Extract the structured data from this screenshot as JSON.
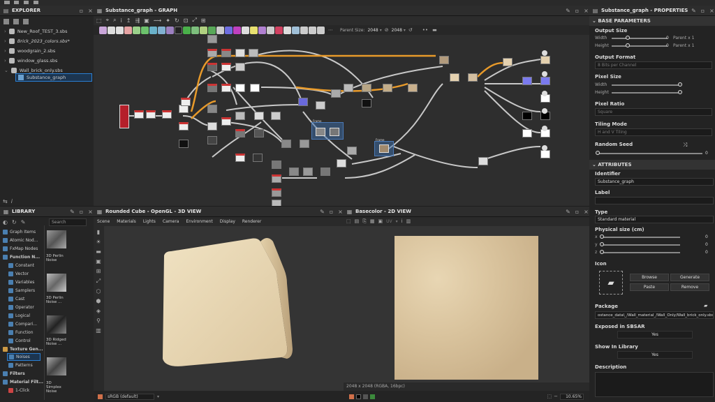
{
  "explorer": {
    "title": "EXPLORER",
    "files": [
      "New_Roof_TEST_3.sbs",
      "Brick_2023_colors.sbs*",
      "woodgrain_2.sbs",
      "window_glass.sbs",
      "Wall_brick_only.sbs"
    ],
    "graph_item": "Substance_graph"
  },
  "graph": {
    "title": "Substance_graph - GRAPH",
    "parent_size_label": "Parent Size:",
    "parent_size_value": "2048",
    "size_value": "2048",
    "frame_label_1": "Frame",
    "frame_label_2": "Frame"
  },
  "properties": {
    "title": "Substance_graph - PROPERTIES",
    "base_params": "BASE PARAMETERS",
    "output_size": "Output Size",
    "width_label": "Width",
    "height_label": "Height",
    "width_val": "0",
    "height_val": "0",
    "parent_x1a": "Parent x 1",
    "parent_x1b": "Parent x 1",
    "output_format": "Output Format",
    "output_format_val": "8 Bits per Channel",
    "pixel_size": "Pixel Size",
    "px_width": "Width",
    "px_height": "Height",
    "pixel_ratio": "Pixel Ratio",
    "pixel_ratio_val": "Square",
    "tiling_mode": "Tiling Mode",
    "tiling_val": "H and V Tiling",
    "random_seed": "Random Seed",
    "seed_val": "0",
    "attributes": "ATTRIBUTES",
    "identifier": "Identifier",
    "identifier_val": "Substance_graph",
    "label": "Label",
    "type": "Type",
    "type_val": "Standard material",
    "physical_size": "Physical size (cm)",
    "px": "x",
    "py": "y",
    "pz": "z",
    "pxv": "0",
    "pyv": "0",
    "pzv": "0",
    "icon": "Icon",
    "browse": "Browse",
    "generate": "Generate",
    "paste": "Paste",
    "remove": "Remove",
    "package": "Package",
    "package_val": "ostance_data\\_/Wall_material_/Wall_Only/Wall_brick_only.sbs",
    "exposed": "Exposed in SBSAR",
    "exposed_val": "Yes",
    "show_lib": "Show In Library",
    "show_lib_val": "Yes",
    "description": "Description"
  },
  "library": {
    "title": "LIBRARY",
    "search_placeholder": "Search",
    "items": [
      "Graph Items",
      "Atomic Nod...",
      "FxMap Nodes",
      "Function N...",
      "Constant",
      "Vector",
      "Variables",
      "Samplers",
      "Cast",
      "Operator",
      "Logical",
      "Compari...",
      "Function",
      "Control",
      "Texture Gen...",
      "Noises",
      "Patterns",
      "Filters",
      "Material Filt...",
      "1-Click"
    ],
    "thumbs": [
      "3D Perlin Noise",
      "3D Perlin Noise ...",
      "3D Ridged Noise ...",
      "3D Simplex Noise"
    ]
  },
  "view3d": {
    "title": "Rounded Cube - OpenGL - 3D VIEW",
    "menu": [
      "Scene",
      "Materials",
      "Lights",
      "Camera",
      "Environment",
      "Display",
      "Renderer"
    ],
    "colorspace": "sRGB (default)"
  },
  "view2d": {
    "title": "Basecolor - 2D VIEW",
    "uv": "UV",
    "status": "2048 x 2048 (RGBA, 16bpc)",
    "zoom": "10.65%"
  },
  "colors": {
    "accent": "#2a7fd4",
    "node_red": "#c8262f",
    "wire_orange": "#e89a2a",
    "cube": "#e6d6b4"
  }
}
